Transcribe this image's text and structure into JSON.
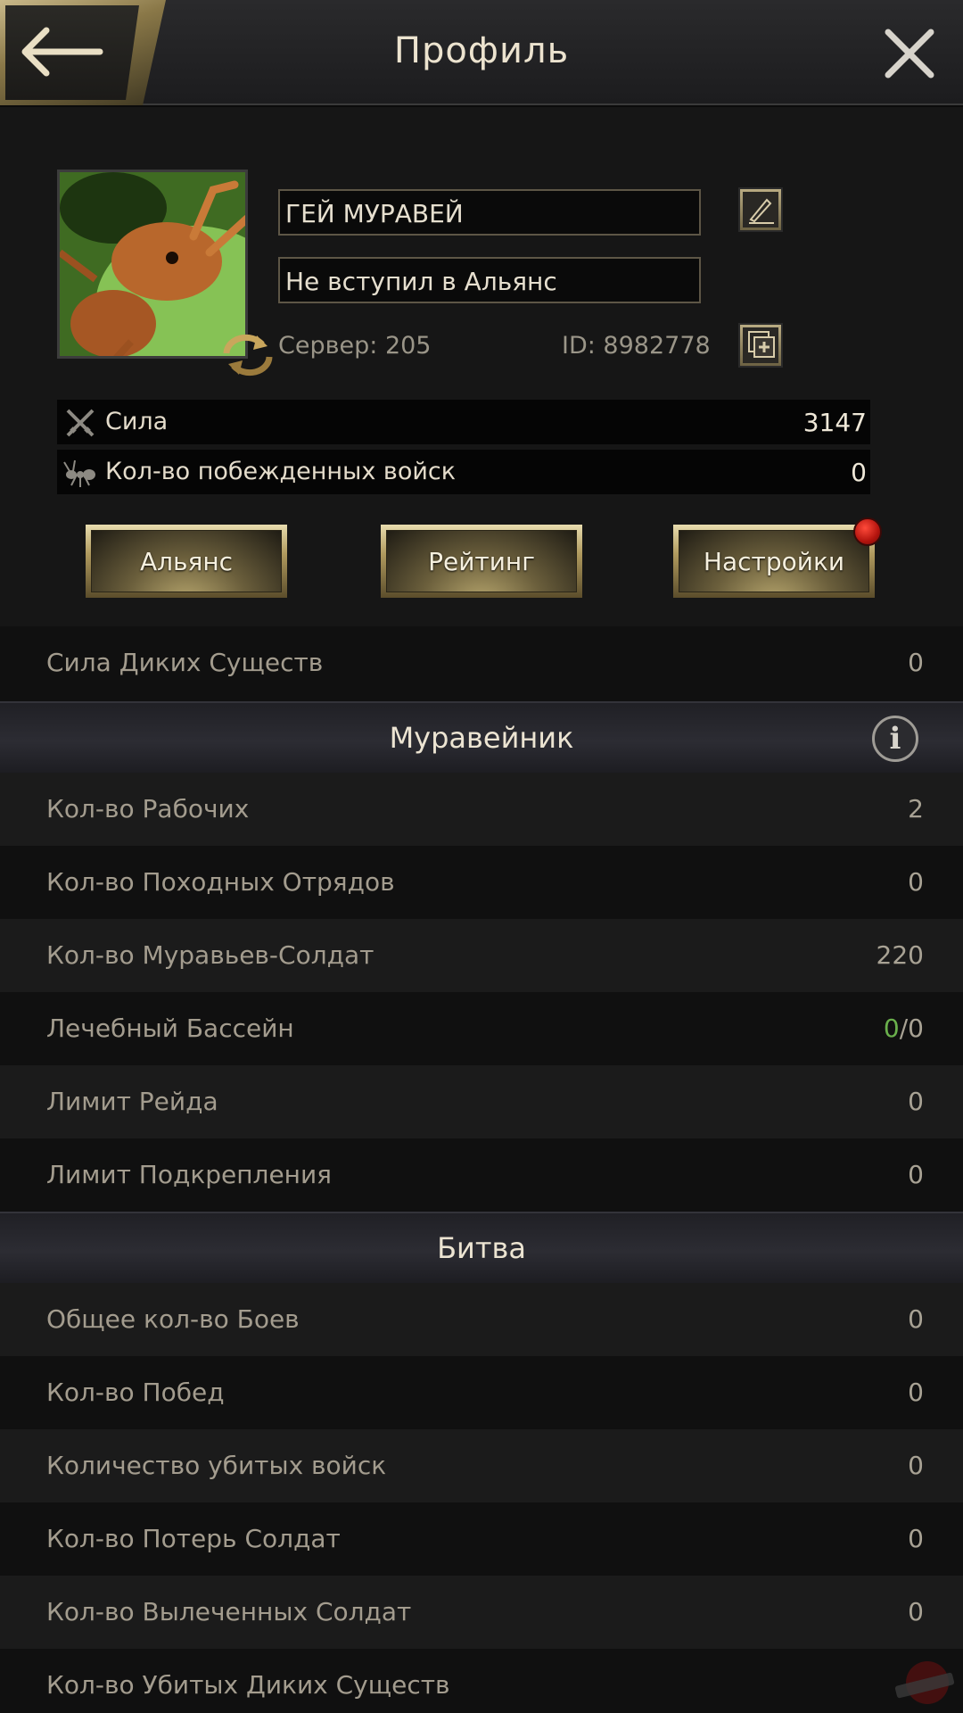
{
  "header": {
    "title": "Профиль"
  },
  "profile": {
    "name": "ГЕЙ МУРАВЕЙ",
    "alliance": "Не вступил в Альянс",
    "server": "Сервер: 205",
    "id": "ID: 8982778"
  },
  "stats": [
    {
      "label": "Сила",
      "value": "3147",
      "icon": "crossed-swords-icon"
    },
    {
      "label": "Кол-во побежденных войск",
      "value": "0",
      "icon": "ant-icon"
    }
  ],
  "buttons": {
    "alliance": "Альянс",
    "rating": "Рейтинг",
    "settings": "Настройки"
  },
  "wild_power": {
    "label": "Сила Диких Существ",
    "value": "0"
  },
  "anthill": {
    "title": "Муравейник",
    "rows": [
      {
        "label": "Кол-во Рабочих",
        "value": "2"
      },
      {
        "label": "Кол-во Походных Отрядов",
        "value": "0"
      },
      {
        "label": "Кол-во Муравьев-Солдат",
        "value": "220"
      },
      {
        "label": "Лечебный Бассейн",
        "value_green": "0",
        "value_rest": "/0"
      },
      {
        "label": "Лимит Рейда",
        "value": "0"
      },
      {
        "label": "Лимит Подкрепления",
        "value": "0"
      }
    ]
  },
  "battle": {
    "title": "Битва",
    "rows": [
      {
        "label": "Общее кол-во Боев",
        "value": "0"
      },
      {
        "label": "Кол-во Побед",
        "value": "0"
      },
      {
        "label": "Количество убитых войск",
        "value": "0"
      },
      {
        "label": "Кол-во Потерь Солдат",
        "value": "0"
      },
      {
        "label": "Кол-во Вылеченных Солдат",
        "value": "0"
      },
      {
        "label": "Кол-во Убитых Диких Существ",
        "value": ""
      }
    ]
  },
  "colors": {
    "accent_gold": "#b09a5e",
    "green": "#6ab04c",
    "badge_red": "#d0201a"
  }
}
